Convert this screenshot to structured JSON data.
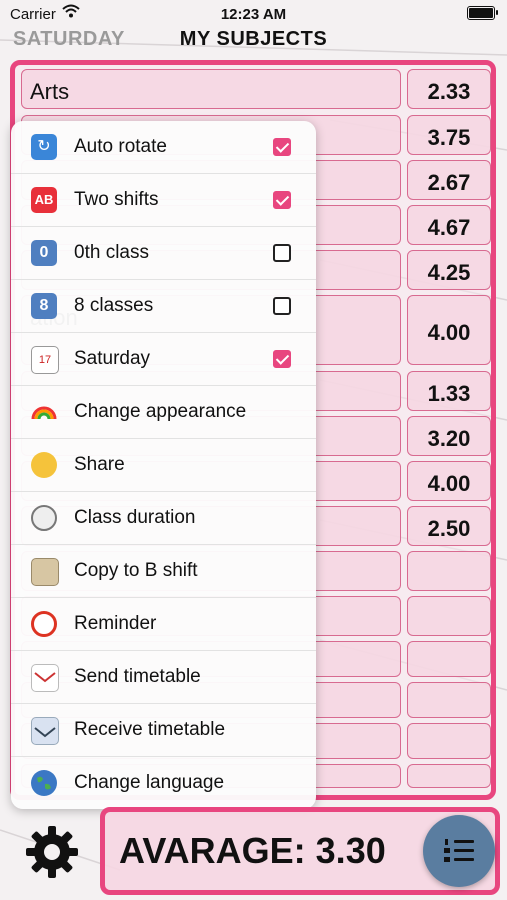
{
  "status_bar": {
    "carrier": "Carrier",
    "time": "12:23 AM"
  },
  "header": {
    "back_label": "SATURDAY",
    "title": "MY SUBJECTS"
  },
  "subjects": [
    {
      "name": "Arts",
      "grade": "2.33"
    },
    {
      "name": "",
      "grade": "3.75"
    },
    {
      "name": "",
      "grade": "2.67"
    },
    {
      "name": "",
      "grade": "4.67"
    },
    {
      "name": "",
      "grade": "4.25"
    },
    {
      "name": "ation",
      "grade": "4.00"
    },
    {
      "name": "",
      "grade": "1.33"
    },
    {
      "name": "",
      "grade": "3.20"
    },
    {
      "name": "",
      "grade": "4.00"
    },
    {
      "name": "",
      "grade": "2.50"
    },
    {
      "name": "",
      "grade": ""
    },
    {
      "name": "",
      "grade": ""
    },
    {
      "name": "",
      "grade": ""
    },
    {
      "name": "",
      "grade": ""
    },
    {
      "name": "",
      "grade": ""
    },
    {
      "name": "",
      "grade": ""
    }
  ],
  "menu": {
    "items": [
      {
        "label": "Auto rotate",
        "icon": "rotate-icon",
        "checked": true
      },
      {
        "label": "Two shifts",
        "icon": "ab-icon",
        "checked": true
      },
      {
        "label": "0th class",
        "icon": "zero-icon",
        "checked": false
      },
      {
        "label": "8 classes",
        "icon": "eight-icon",
        "checked": false
      },
      {
        "label": "Saturday",
        "icon": "calendar-icon",
        "checked": true
      },
      {
        "label": "Change appearance",
        "icon": "rainbow-icon"
      },
      {
        "label": "Share",
        "icon": "thumbs-up-icon"
      },
      {
        "label": "Class duration",
        "icon": "stopwatch-icon"
      },
      {
        "label": "Copy to B shift",
        "icon": "clipboard-icon"
      },
      {
        "label": "Reminder",
        "icon": "alarm-clock-icon"
      },
      {
        "label": "Send timetable",
        "icon": "envelope-out-icon"
      },
      {
        "label": "Receive timetable",
        "icon": "envelope-in-icon"
      },
      {
        "label": "Change language",
        "icon": "globe-icon"
      }
    ],
    "icon_glyphs": {
      "zero": "0",
      "eight": "8",
      "ab": "AB",
      "calendar": "17"
    }
  },
  "footer": {
    "average_label": "AVARAGE: 3.30"
  },
  "colors": {
    "accent": "#e8467f",
    "cell_bg": "#f6d6e2",
    "fab": "#5a7da0"
  }
}
